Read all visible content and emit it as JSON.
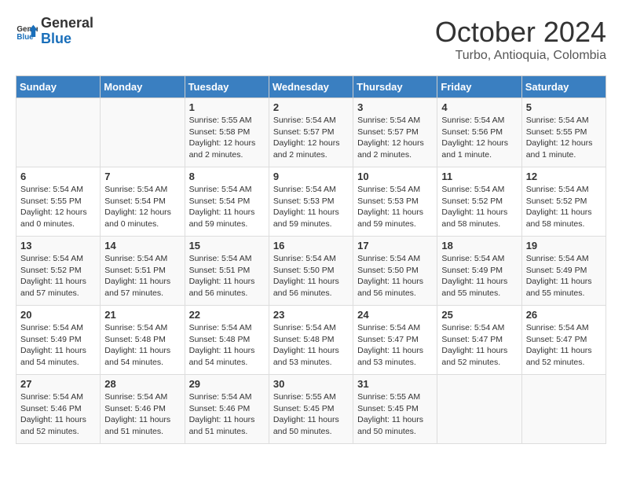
{
  "header": {
    "logo_general": "General",
    "logo_blue": "Blue",
    "month": "October 2024",
    "location": "Turbo, Antioquia, Colombia"
  },
  "days_of_week": [
    "Sunday",
    "Monday",
    "Tuesday",
    "Wednesday",
    "Thursday",
    "Friday",
    "Saturday"
  ],
  "weeks": [
    [
      {
        "day": "",
        "info": ""
      },
      {
        "day": "",
        "info": ""
      },
      {
        "day": "1",
        "info": "Sunrise: 5:55 AM\nSunset: 5:58 PM\nDaylight: 12 hours\nand 2 minutes."
      },
      {
        "day": "2",
        "info": "Sunrise: 5:54 AM\nSunset: 5:57 PM\nDaylight: 12 hours\nand 2 minutes."
      },
      {
        "day": "3",
        "info": "Sunrise: 5:54 AM\nSunset: 5:57 PM\nDaylight: 12 hours\nand 2 minutes."
      },
      {
        "day": "4",
        "info": "Sunrise: 5:54 AM\nSunset: 5:56 PM\nDaylight: 12 hours\nand 1 minute."
      },
      {
        "day": "5",
        "info": "Sunrise: 5:54 AM\nSunset: 5:55 PM\nDaylight: 12 hours\nand 1 minute."
      }
    ],
    [
      {
        "day": "6",
        "info": "Sunrise: 5:54 AM\nSunset: 5:55 PM\nDaylight: 12 hours\nand 0 minutes."
      },
      {
        "day": "7",
        "info": "Sunrise: 5:54 AM\nSunset: 5:54 PM\nDaylight: 12 hours\nand 0 minutes."
      },
      {
        "day": "8",
        "info": "Sunrise: 5:54 AM\nSunset: 5:54 PM\nDaylight: 11 hours\nand 59 minutes."
      },
      {
        "day": "9",
        "info": "Sunrise: 5:54 AM\nSunset: 5:53 PM\nDaylight: 11 hours\nand 59 minutes."
      },
      {
        "day": "10",
        "info": "Sunrise: 5:54 AM\nSunset: 5:53 PM\nDaylight: 11 hours\nand 59 minutes."
      },
      {
        "day": "11",
        "info": "Sunrise: 5:54 AM\nSunset: 5:52 PM\nDaylight: 11 hours\nand 58 minutes."
      },
      {
        "day": "12",
        "info": "Sunrise: 5:54 AM\nSunset: 5:52 PM\nDaylight: 11 hours\nand 58 minutes."
      }
    ],
    [
      {
        "day": "13",
        "info": "Sunrise: 5:54 AM\nSunset: 5:52 PM\nDaylight: 11 hours\nand 57 minutes."
      },
      {
        "day": "14",
        "info": "Sunrise: 5:54 AM\nSunset: 5:51 PM\nDaylight: 11 hours\nand 57 minutes."
      },
      {
        "day": "15",
        "info": "Sunrise: 5:54 AM\nSunset: 5:51 PM\nDaylight: 11 hours\nand 56 minutes."
      },
      {
        "day": "16",
        "info": "Sunrise: 5:54 AM\nSunset: 5:50 PM\nDaylight: 11 hours\nand 56 minutes."
      },
      {
        "day": "17",
        "info": "Sunrise: 5:54 AM\nSunset: 5:50 PM\nDaylight: 11 hours\nand 56 minutes."
      },
      {
        "day": "18",
        "info": "Sunrise: 5:54 AM\nSunset: 5:49 PM\nDaylight: 11 hours\nand 55 minutes."
      },
      {
        "day": "19",
        "info": "Sunrise: 5:54 AM\nSunset: 5:49 PM\nDaylight: 11 hours\nand 55 minutes."
      }
    ],
    [
      {
        "day": "20",
        "info": "Sunrise: 5:54 AM\nSunset: 5:49 PM\nDaylight: 11 hours\nand 54 minutes."
      },
      {
        "day": "21",
        "info": "Sunrise: 5:54 AM\nSunset: 5:48 PM\nDaylight: 11 hours\nand 54 minutes."
      },
      {
        "day": "22",
        "info": "Sunrise: 5:54 AM\nSunset: 5:48 PM\nDaylight: 11 hours\nand 54 minutes."
      },
      {
        "day": "23",
        "info": "Sunrise: 5:54 AM\nSunset: 5:48 PM\nDaylight: 11 hours\nand 53 minutes."
      },
      {
        "day": "24",
        "info": "Sunrise: 5:54 AM\nSunset: 5:47 PM\nDaylight: 11 hours\nand 53 minutes."
      },
      {
        "day": "25",
        "info": "Sunrise: 5:54 AM\nSunset: 5:47 PM\nDaylight: 11 hours\nand 52 minutes."
      },
      {
        "day": "26",
        "info": "Sunrise: 5:54 AM\nSunset: 5:47 PM\nDaylight: 11 hours\nand 52 minutes."
      }
    ],
    [
      {
        "day": "27",
        "info": "Sunrise: 5:54 AM\nSunset: 5:46 PM\nDaylight: 11 hours\nand 52 minutes."
      },
      {
        "day": "28",
        "info": "Sunrise: 5:54 AM\nSunset: 5:46 PM\nDaylight: 11 hours\nand 51 minutes."
      },
      {
        "day": "29",
        "info": "Sunrise: 5:54 AM\nSunset: 5:46 PM\nDaylight: 11 hours\nand 51 minutes."
      },
      {
        "day": "30",
        "info": "Sunrise: 5:55 AM\nSunset: 5:45 PM\nDaylight: 11 hours\nand 50 minutes."
      },
      {
        "day": "31",
        "info": "Sunrise: 5:55 AM\nSunset: 5:45 PM\nDaylight: 11 hours\nand 50 minutes."
      },
      {
        "day": "",
        "info": ""
      },
      {
        "day": "",
        "info": ""
      }
    ]
  ]
}
